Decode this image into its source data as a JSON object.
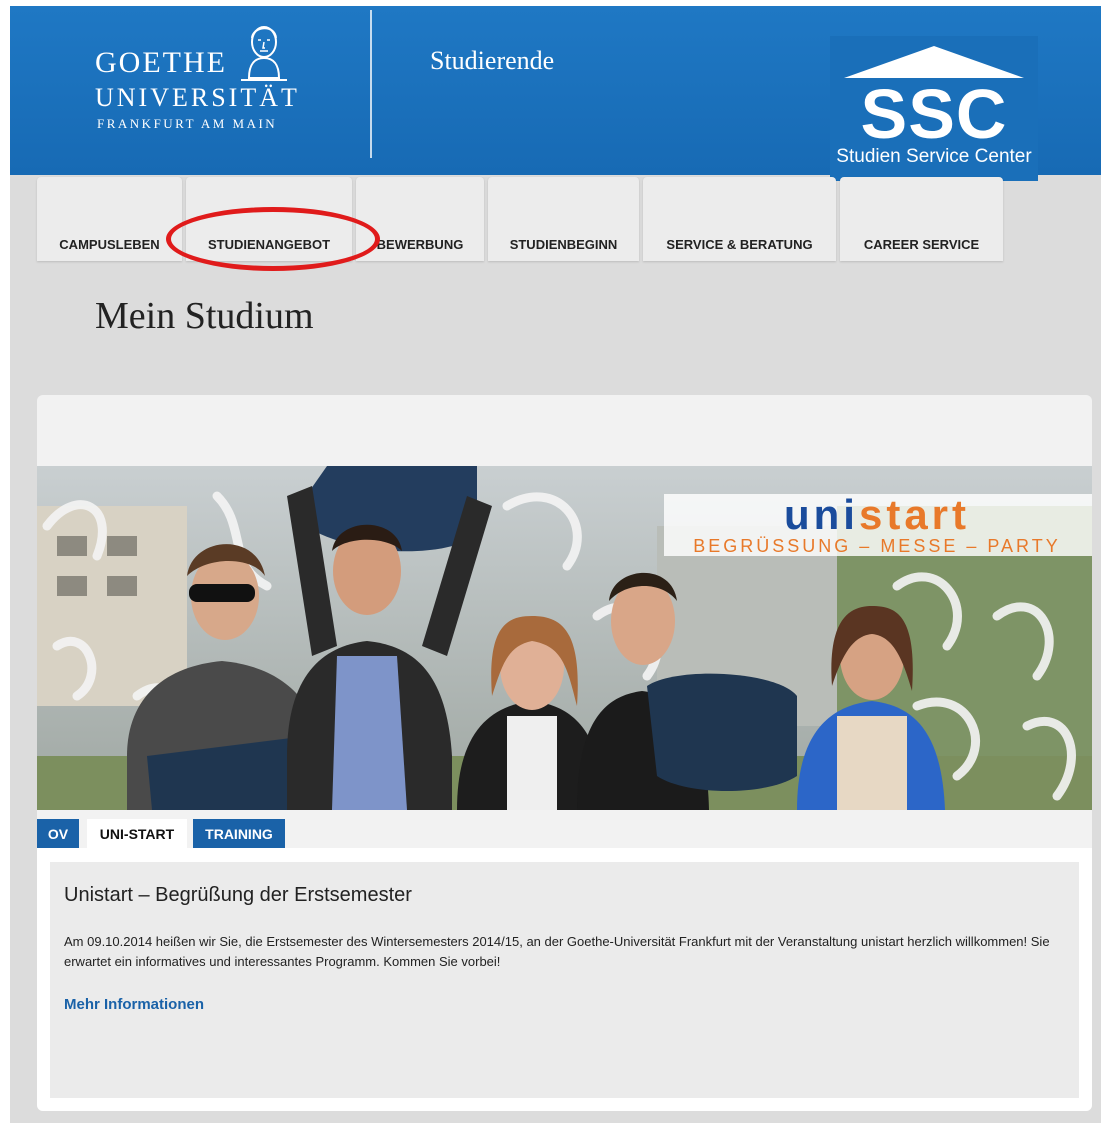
{
  "header": {
    "logo_line1": "GOETHE",
    "logo_line2": "UNIVERSITÄT",
    "logo_line3": "FRANKFURT AM MAIN",
    "section_title": "Studierende",
    "ssc_big": "SSC",
    "ssc_small": "Studien Service Center"
  },
  "nav": {
    "items": [
      {
        "label": "CAMPUSLEBEN"
      },
      {
        "label": "STUDIENANGEBOT"
      },
      {
        "label": "BEWERBUNG"
      },
      {
        "label": "STUDIENBEGINN"
      },
      {
        "label": "SERVICE & BERATUNG"
      },
      {
        "label": "CAREER SERVICE"
      }
    ]
  },
  "page_title": "Mein Studium",
  "banner": {
    "brand_part1": "uni",
    "brand_part2": "start",
    "tagline": "BEGRÜSSUNG – MESSE – PARTY"
  },
  "tabs": [
    {
      "label": "OV"
    },
    {
      "label": "UNI-START"
    },
    {
      "label": "TRAINING"
    }
  ],
  "panel": {
    "title": "Unistart – Begrüßung der Erstsemester",
    "text": "Am 09.10.2014 heißen wir Sie, die Erstsemester des Wintersemesters 2014/15, an der Goethe-Universität Frankfurt mit der Veranstaltung unistart herzlich willkommen! Sie erwartet ein informatives und interessantes Programm. Kommen Sie vorbei!",
    "link": "Mehr Informationen"
  },
  "colors": {
    "header_blue": "#1a6fb9",
    "tab_blue": "#1a62a8",
    "highlight_red": "#e01b1b",
    "unistart_blue": "#1a4c9c",
    "unistart_orange": "#e8792a"
  },
  "icons": {
    "logo": "goethe-portrait-icon",
    "ssc": "house-roof-icon"
  }
}
